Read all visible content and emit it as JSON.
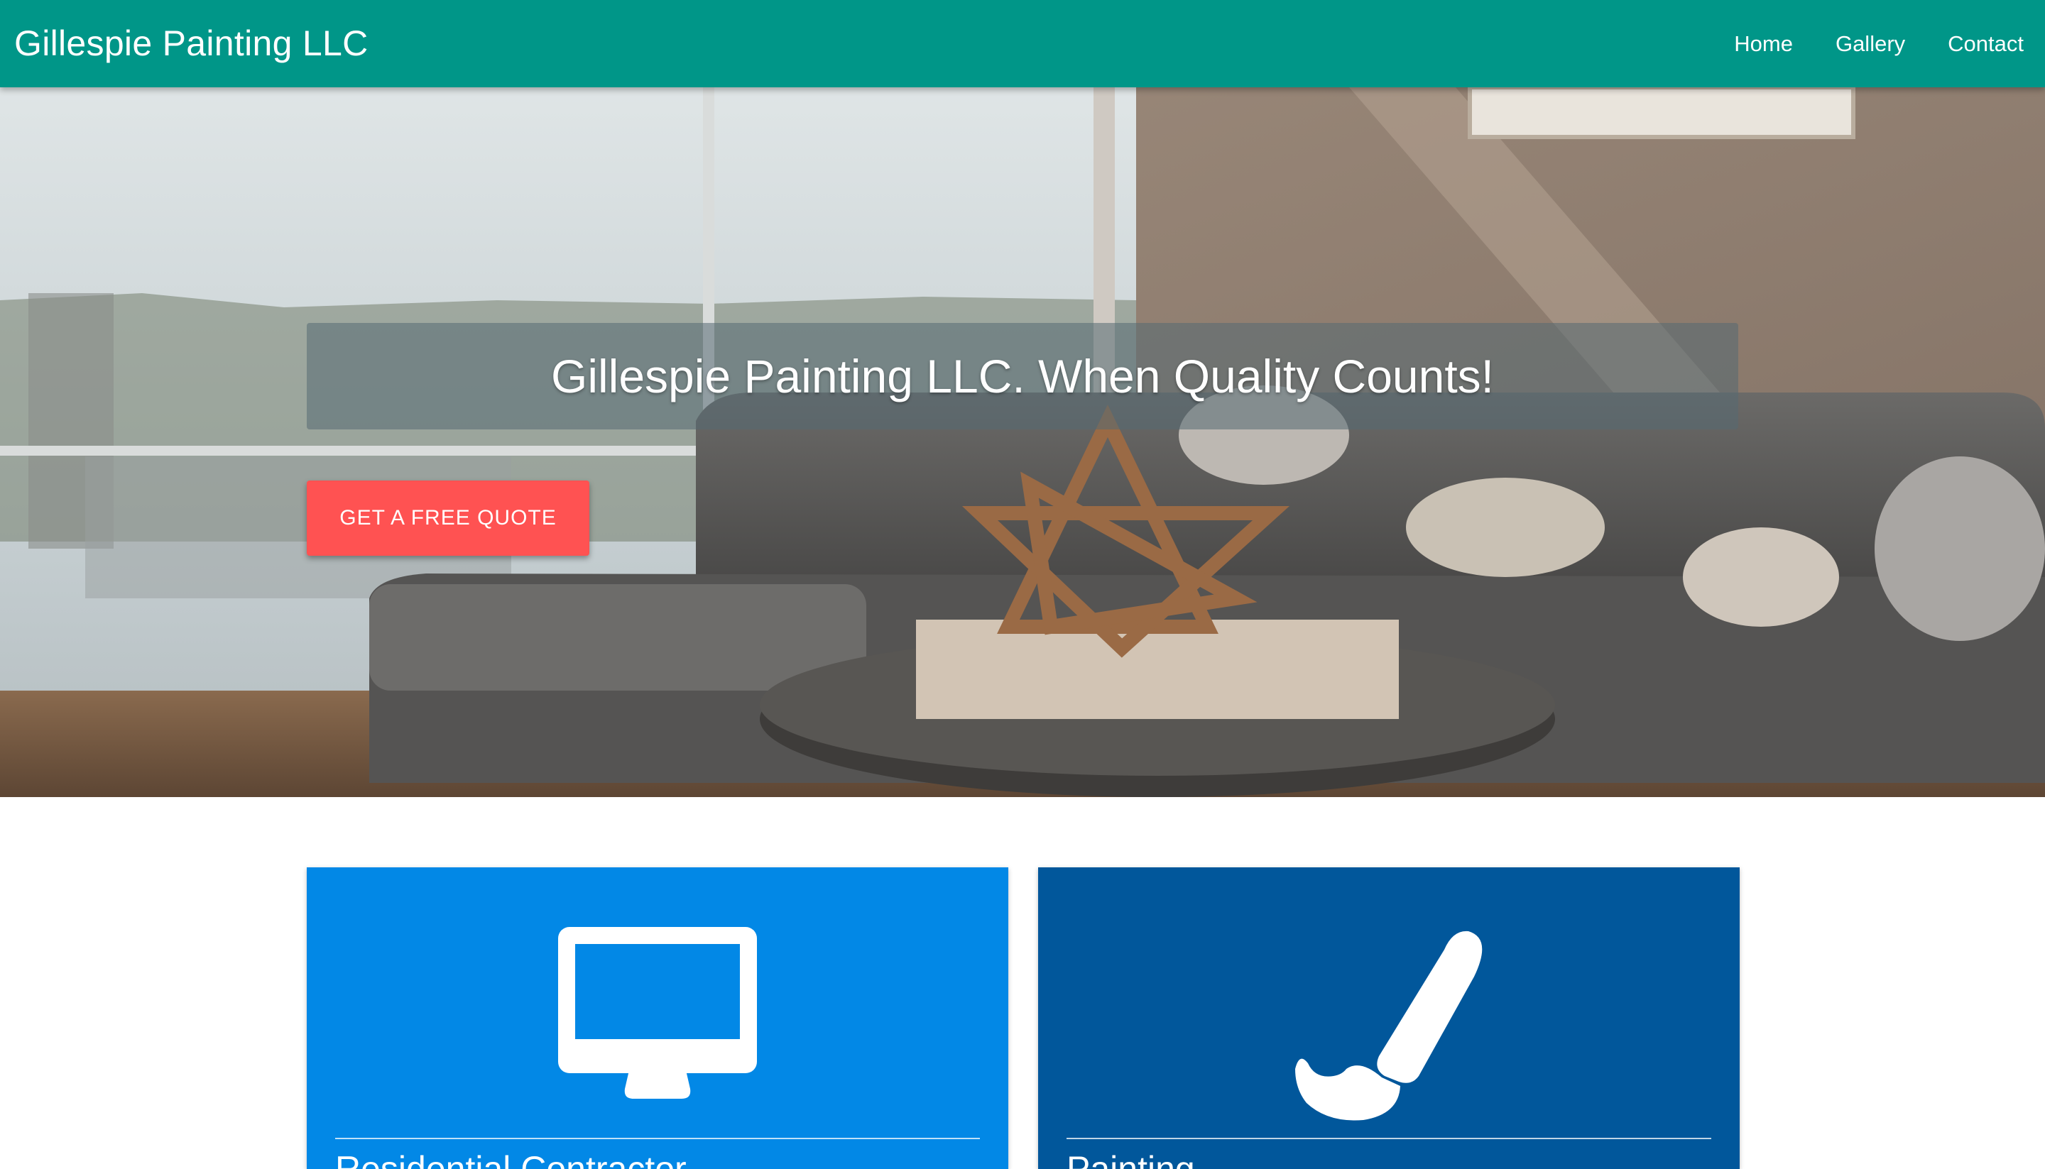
{
  "navbar": {
    "brand": "Gillespie Painting LLC",
    "links": [
      "Home",
      "Gallery",
      "Contact"
    ]
  },
  "hero": {
    "title": "Gillespie Painting LLC. When Quality Counts!",
    "cta_label": "GET A FREE QUOTE"
  },
  "cards": [
    {
      "title": "Residential Contractor",
      "icon": "desktop-monitor-icon",
      "color": "#0288e6"
    },
    {
      "title": "Painting",
      "icon": "paintbrush-icon",
      "color": "#01579b"
    }
  ],
  "colors": {
    "navbar": "#009688",
    "cta": "#ff5252"
  }
}
